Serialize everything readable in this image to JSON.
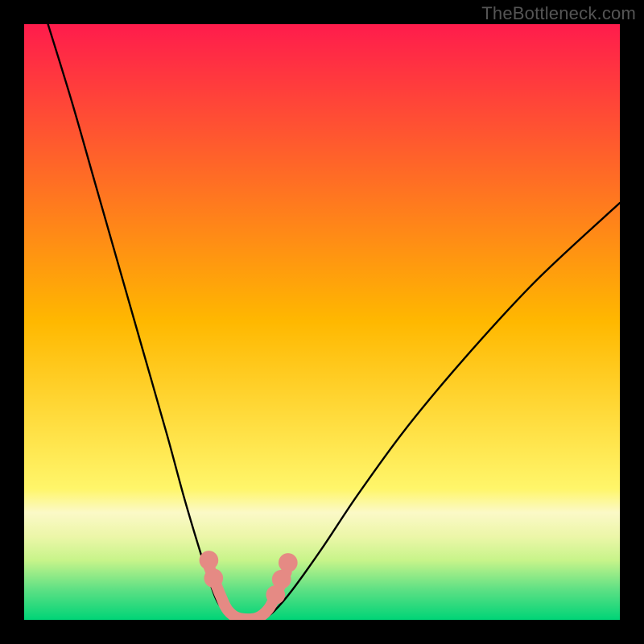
{
  "watermark": {
    "text": "TheBottleneck.com"
  },
  "chart_data": {
    "type": "line",
    "title": "",
    "xlabel": "",
    "ylabel": "",
    "xlim": [
      0,
      100
    ],
    "ylim": [
      0,
      100
    ],
    "grid": false,
    "background_gradient": {
      "stops": [
        {
          "offset": 0.0,
          "color": "#ff1c4c"
        },
        {
          "offset": 0.5,
          "color": "#ffb800"
        },
        {
          "offset": 0.78,
          "color": "#fff66a"
        },
        {
          "offset": 0.82,
          "color": "#fbf9c7"
        },
        {
          "offset": 0.86,
          "color": "#ecf6a8"
        },
        {
          "offset": 0.9,
          "color": "#c7f48a"
        },
        {
          "offset": 0.95,
          "color": "#5ce084"
        },
        {
          "offset": 1.0,
          "color": "#00d477"
        }
      ]
    },
    "series": [
      {
        "name": "left_curve",
        "stroke": "#000000",
        "x": [
          4,
          8,
          12,
          16,
          20,
          24,
          27,
          30,
          32,
          33.5,
          35
        ],
        "y": [
          100,
          87,
          73,
          59,
          45,
          31,
          20,
          10,
          4,
          1.5,
          0
        ]
      },
      {
        "name": "right_curve",
        "stroke": "#000000",
        "x": [
          40,
          42,
          45,
          50,
          56,
          64,
          74,
          86,
          100
        ],
        "y": [
          0,
          1.5,
          5,
          12,
          21,
          32,
          44,
          57,
          70
        ]
      },
      {
        "name": "basin",
        "stroke": "#e58a84",
        "x": [
          31,
          33,
          34.2,
          36,
          39,
          41,
          42.4,
          44
        ],
        "y": [
          9,
          4,
          1.6,
          0.3,
          0.3,
          1.8,
          4.5,
          8
        ]
      }
    ],
    "markers": [
      {
        "series": "basin",
        "cx": 31.0,
        "cy": 10.0,
        "r": 1.6,
        "fill": "#e58a84"
      },
      {
        "series": "basin",
        "cx": 31.8,
        "cy": 7.0,
        "r": 1.6,
        "fill": "#e58a84"
      },
      {
        "series": "basin",
        "cx": 42.2,
        "cy": 4.2,
        "r": 1.6,
        "fill": "#e58a84"
      },
      {
        "series": "basin",
        "cx": 43.2,
        "cy": 6.8,
        "r": 1.6,
        "fill": "#e58a84"
      },
      {
        "series": "basin",
        "cx": 44.3,
        "cy": 9.6,
        "r": 1.6,
        "fill": "#e58a84"
      }
    ]
  }
}
